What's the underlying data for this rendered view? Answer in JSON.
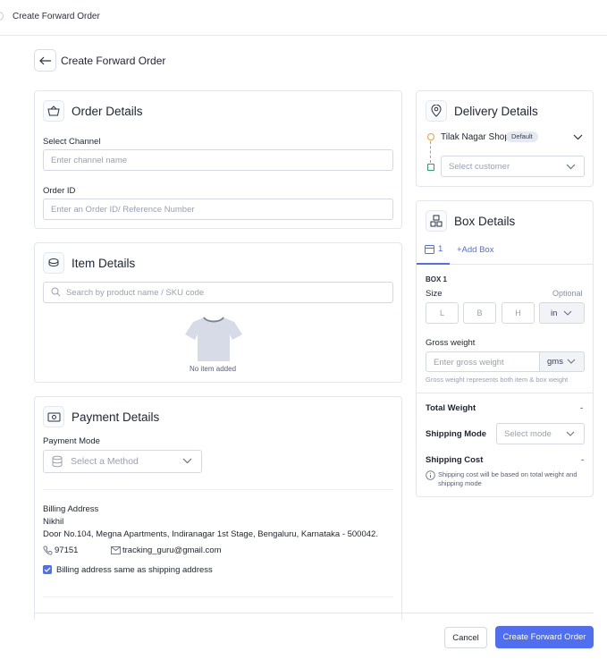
{
  "topbar": {
    "title": "Create Forward Order"
  },
  "page": {
    "title": "Create Forward Order"
  },
  "order_details": {
    "title": "Order Details",
    "channel_label": "Select Channel",
    "channel_placeholder": "Enter channel name",
    "order_id_label": "Order ID",
    "order_id_placeholder": "Enter an Order ID/ Reference Number"
  },
  "item_details": {
    "title": "Item Details",
    "search_placeholder": "Search by product name / SKU code",
    "empty_text": "No item added"
  },
  "payment_details": {
    "title": "Payment Details",
    "mode_label": "Payment Mode",
    "mode_placeholder": "Select a Method",
    "billing_label": "Billing Address",
    "billing_name": "Nikhil",
    "billing_address": "Door No.104, Megna Apartments, Indiranagar 1st Stage,  Bengaluru, Karnataka - 500042.",
    "phone": "97151",
    "email": "tracking_guru@gmail.com",
    "same_as_shipping": "Billing address same as shipping address",
    "same_checked": true
  },
  "delivery_details": {
    "title": "Delivery Details",
    "pickup_name": "Tilak Nagar Shop",
    "pickup_badge": "Default",
    "customer_placeholder": "Select customer"
  },
  "box_details": {
    "title": "Box Details",
    "tab_count": "1",
    "add_box": "+Add Box",
    "box_heading": "BOX 1",
    "size_label": "Size",
    "optional": "Optional",
    "dim_l": "L",
    "dim_b": "B",
    "dim_h": "H",
    "dim_unit": "in",
    "gross_weight_label": "Gross weight",
    "gross_weight_placeholder": "Enter gross weight",
    "weight_unit": "gms",
    "gross_weight_hint": "Gross weight represents both item & box weight",
    "total_weight_label": "Total Weight",
    "total_weight_value": "-",
    "shipping_mode_label": "Shipping Mode",
    "shipping_mode_placeholder": "Select mode",
    "shipping_cost_label": "Shipping Cost",
    "shipping_cost_value": "-",
    "shipping_cost_note": "Shipping cost will be based on total weight and shipping mode"
  },
  "footer": {
    "cancel": "Cancel",
    "submit": "Create Forward Order"
  },
  "colors": {
    "primary": "#4f6ef0",
    "pickup_marker": "#f0a030",
    "drop_marker": "#2e9e6a"
  }
}
